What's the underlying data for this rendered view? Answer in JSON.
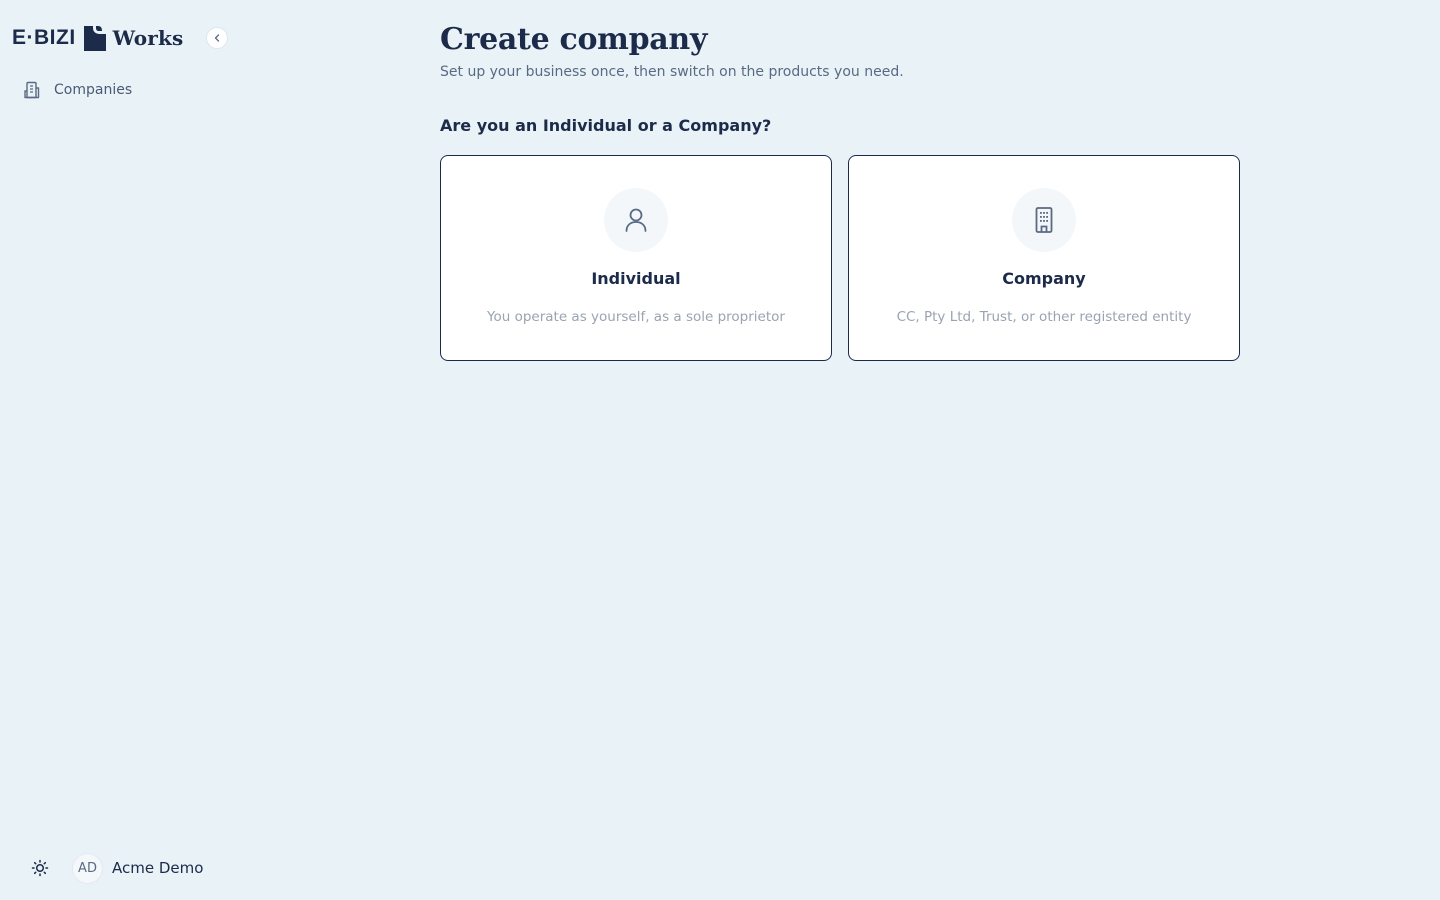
{
  "brand": {
    "left_text": "E·BIZI",
    "right_text": "Works",
    "mark_icon": "document-mark-icon",
    "color": "#1c2b4a"
  },
  "sidebar": {
    "collapse_icon": "chevron-left-icon",
    "items": [
      {
        "label": "Companies",
        "icon": "building-icon"
      }
    ],
    "footer": {
      "theme_icon": "sun-icon",
      "user": {
        "initials": "AD",
        "name": "Acme Demo"
      }
    }
  },
  "main": {
    "title": "Create company",
    "subtitle": "Set up your business once, then switch on the products you need.",
    "question": "Are you an Individual or a Company?",
    "options": [
      {
        "title": "Individual",
        "description": "You operate as yourself, as a sole proprietor",
        "icon": "person-icon"
      },
      {
        "title": "Company",
        "description": "CC, Pty Ltd, Trust, or other registered entity",
        "icon": "building-icon"
      }
    ]
  },
  "colors": {
    "background": "#e9f2f6",
    "text_primary": "#1c2b4a",
    "text_muted": "#9aa3b0",
    "card_bg": "#ffffff"
  }
}
